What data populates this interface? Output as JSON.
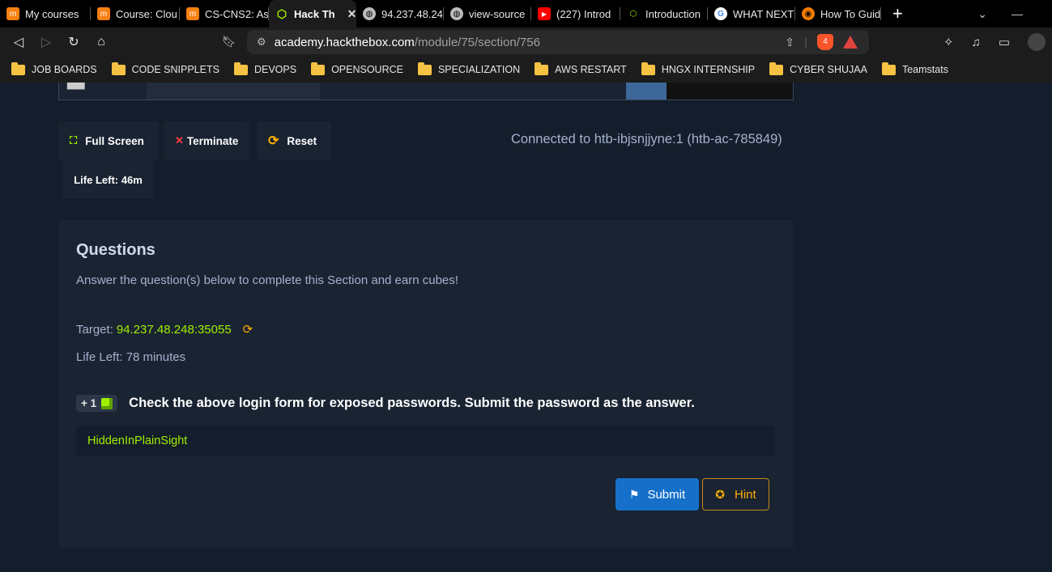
{
  "browser": {
    "tabs": [
      {
        "title": "My courses",
        "icon": "moodle-icon",
        "color": "#f98012"
      },
      {
        "title": "Course: Clou",
        "icon": "moodle-icon",
        "color": "#f98012"
      },
      {
        "title": "CS-CNS2: As",
        "icon": "moodle-icon",
        "color": "#f98012"
      },
      {
        "title": "Hack Th",
        "icon": "htb-cube-icon",
        "color": "#9fef00",
        "active": true
      },
      {
        "title": "94.237.48.24",
        "icon": "globe-icon",
        "color": "#bbbbbb"
      },
      {
        "title": "view-source",
        "icon": "globe-icon",
        "color": "#bbbbbb"
      },
      {
        "title": "(227) Introd",
        "icon": "youtube-icon",
        "color": "#ff0000"
      },
      {
        "title": "Introduction",
        "icon": "htb-cube-icon",
        "color": "#9fef00"
      },
      {
        "title": "WHAT NEXT",
        "icon": "google-icon",
        "color": "#4285f4"
      },
      {
        "title": "How To Guid",
        "icon": "github-icon",
        "color": "#f57c00"
      }
    ],
    "url_host": "academy.hackthebox.com",
    "url_path": "/module/75/section/756",
    "brave_badge": "4",
    "bookmarks": [
      "JOB BOARDS",
      "CODE SNIPPLETS",
      "DEVOPS",
      "OPENSOURCE",
      "SPECIALIZATION",
      "AWS RESTART",
      "HNGX INTERNSHIP",
      "CYBER SHUJAA",
      "Teamstats"
    ]
  },
  "vnc": {
    "fullscreen_label": "Full Screen",
    "terminate_label": "Terminate",
    "reset_label": "Reset",
    "connected_text": "Connected to htb-ibjsnjjyne:1 (htb-ac-785849)",
    "life_left": "Life Left: 46m"
  },
  "questions": {
    "title": "Questions",
    "subtitle": "Answer the question(s) below to complete this Section and earn cubes!",
    "target_label": "Target:",
    "target_ip": "94.237.48.248:35055",
    "life_left": "Life Left: 78 minutes",
    "cube_reward": "+ 1",
    "question_text": "Check the above login form for exposed passwords. Submit the password as the answer.",
    "answer_value": "HiddenInPlainSight",
    "submit_label": "Submit",
    "hint_label": "Hint"
  },
  "colors": {
    "accent_green": "#9fef00",
    "submit_blue": "#1670c9",
    "hint_orange": "#ffaf00",
    "panel_bg": "#1a2332",
    "page_bg": "#141d2b"
  }
}
